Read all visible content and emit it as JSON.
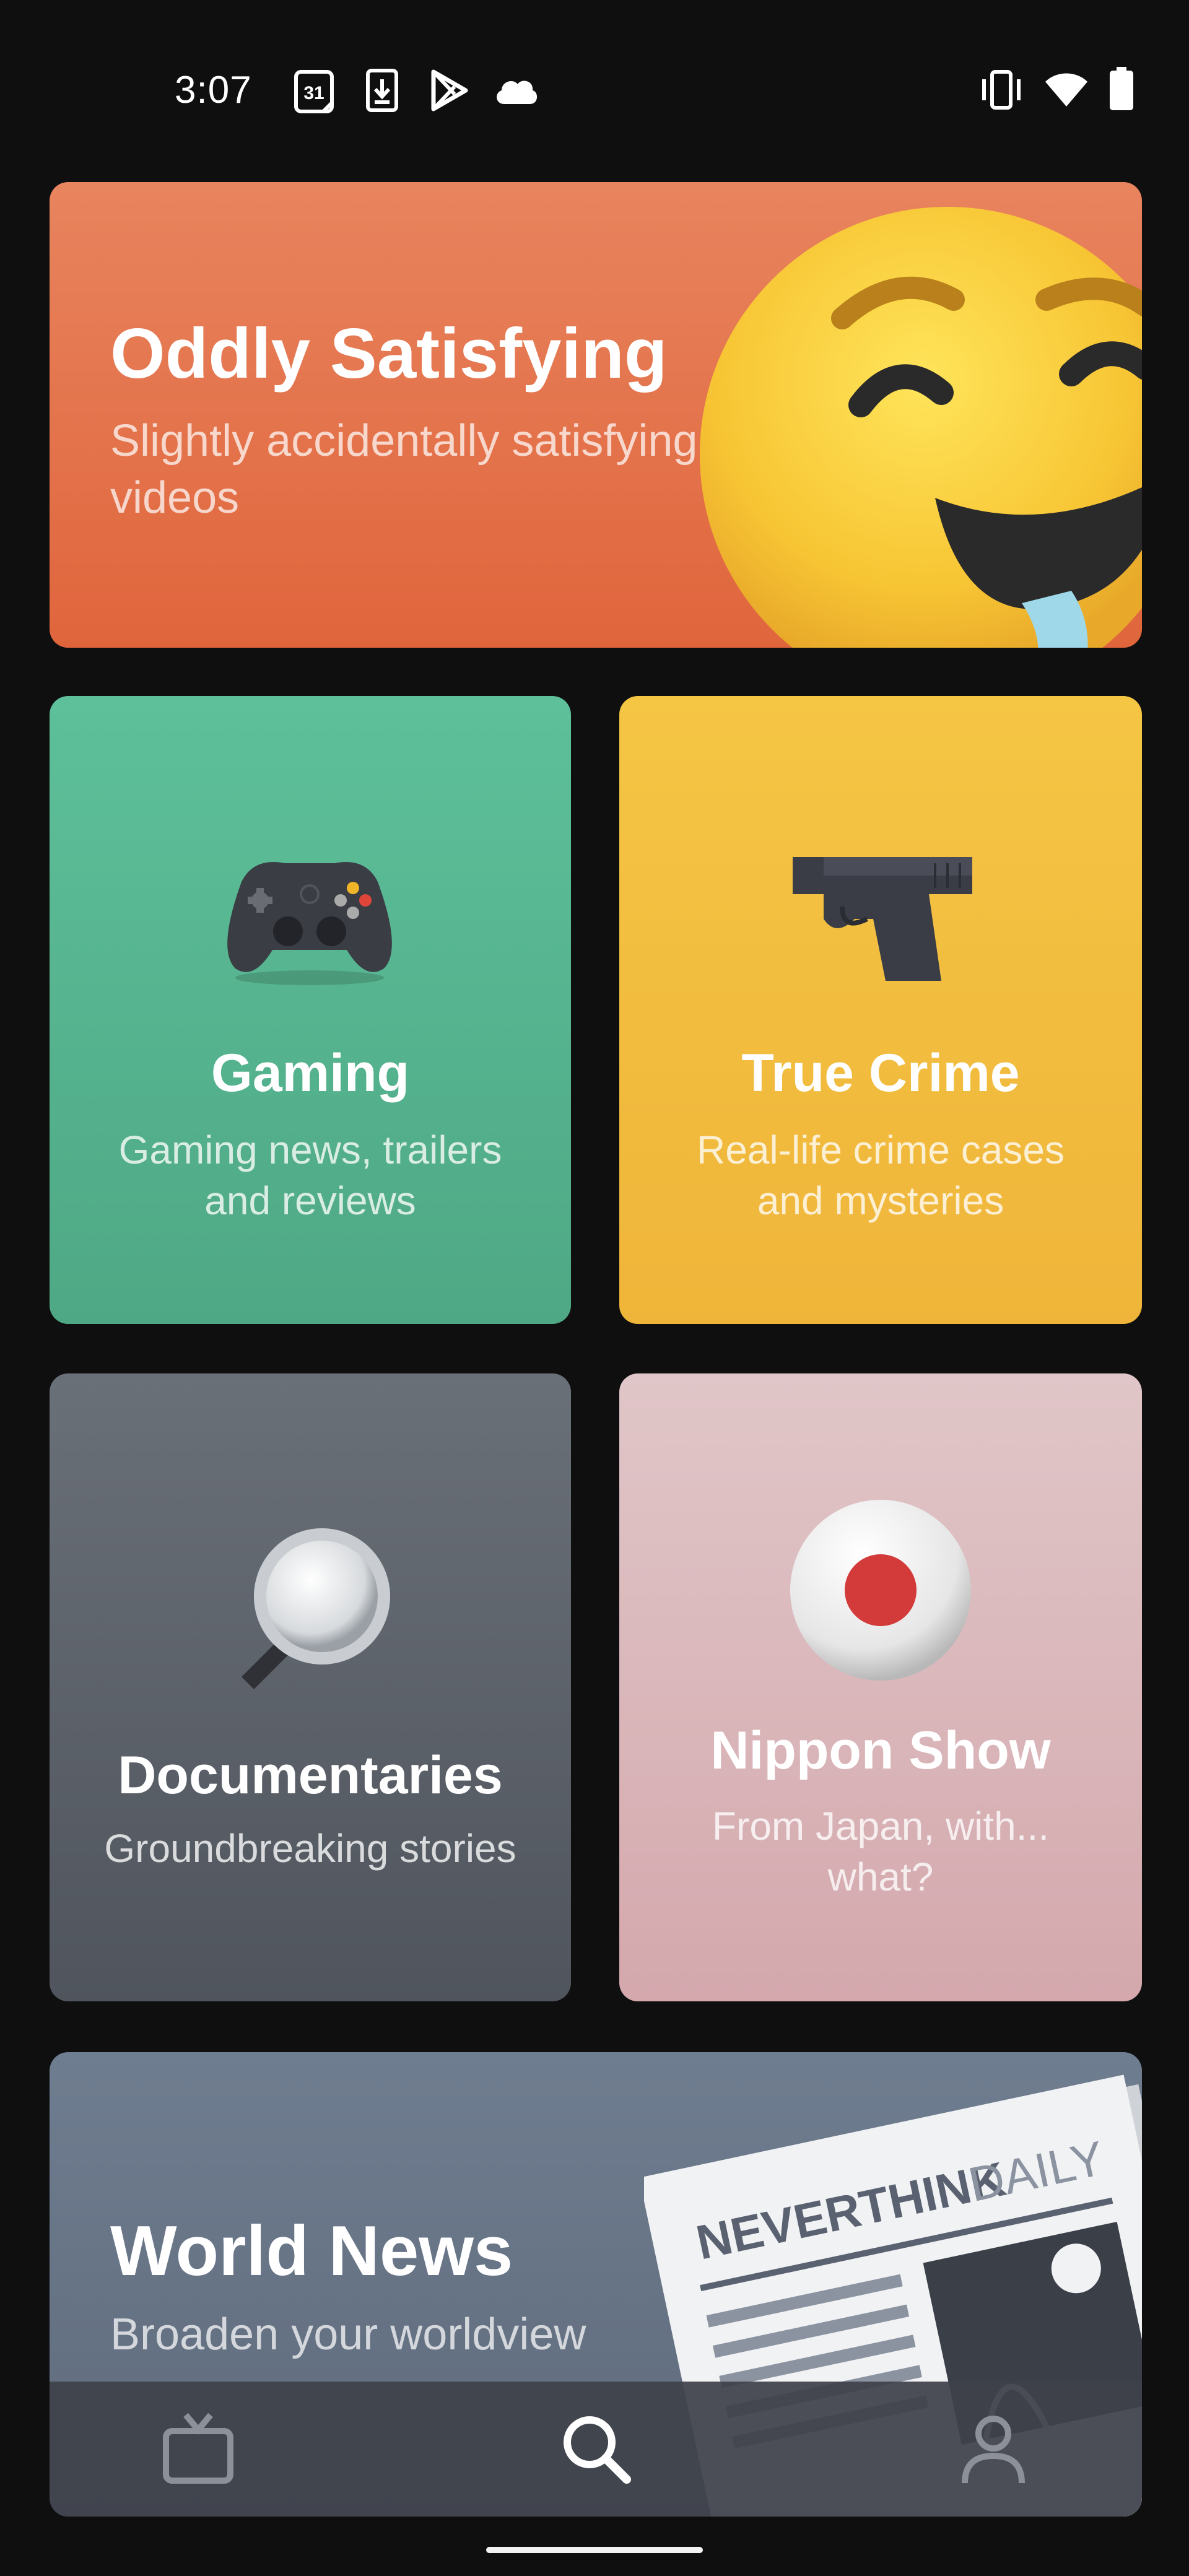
{
  "status_bar": {
    "time": "3:07",
    "calendar_day": "31",
    "left_icons": [
      "calendar-icon",
      "download-icon",
      "play-store-icon",
      "cloud-icon"
    ],
    "right_icons": [
      "vibrate-icon",
      "wifi-icon",
      "battery-icon"
    ]
  },
  "categories": [
    {
      "id": "oddly-satisfying",
      "title": "Oddly Satisfying",
      "subtitle_line1": "Slightly accidentally satisfying",
      "subtitle_line2": "videos",
      "icon": "drooling-face-icon",
      "color": "#e0653c"
    },
    {
      "id": "gaming",
      "title": "Gaming",
      "subtitle_line1": "Gaming news, trailers",
      "subtitle_line2": "and reviews",
      "icon": "game-controller-icon",
      "color": "#5bb895"
    },
    {
      "id": "true-crime",
      "title": "True Crime",
      "subtitle_line1": "Real-life crime cases",
      "subtitle_line2": "and mysteries",
      "icon": "pistol-icon",
      "color": "#f2bf3e"
    },
    {
      "id": "documentaries",
      "title": "Documentaries",
      "subtitle_line1": "Groundbreaking stories",
      "icon": "magnifying-glass-icon",
      "color": "#5e646c"
    },
    {
      "id": "nippon-show",
      "title": "Nippon Show",
      "subtitle_line1": "From Japan, with...",
      "subtitle_line2": "what?",
      "icon": "japan-flag-icon",
      "color": "#d9b0b4"
    },
    {
      "id": "world-news",
      "title": "World News",
      "subtitle_line1": "Broaden your worldview",
      "icon": "newspaper-icon",
      "newspaper_masthead": "NEVERTHINK",
      "newspaper_label": "DAILY",
      "color": "#67768a"
    }
  ],
  "bottom_nav": [
    {
      "id": "tv",
      "icon": "tv-icon",
      "active": false
    },
    {
      "id": "search",
      "icon": "search-icon",
      "active": true
    },
    {
      "id": "profile",
      "icon": "profile-icon",
      "active": false
    }
  ]
}
